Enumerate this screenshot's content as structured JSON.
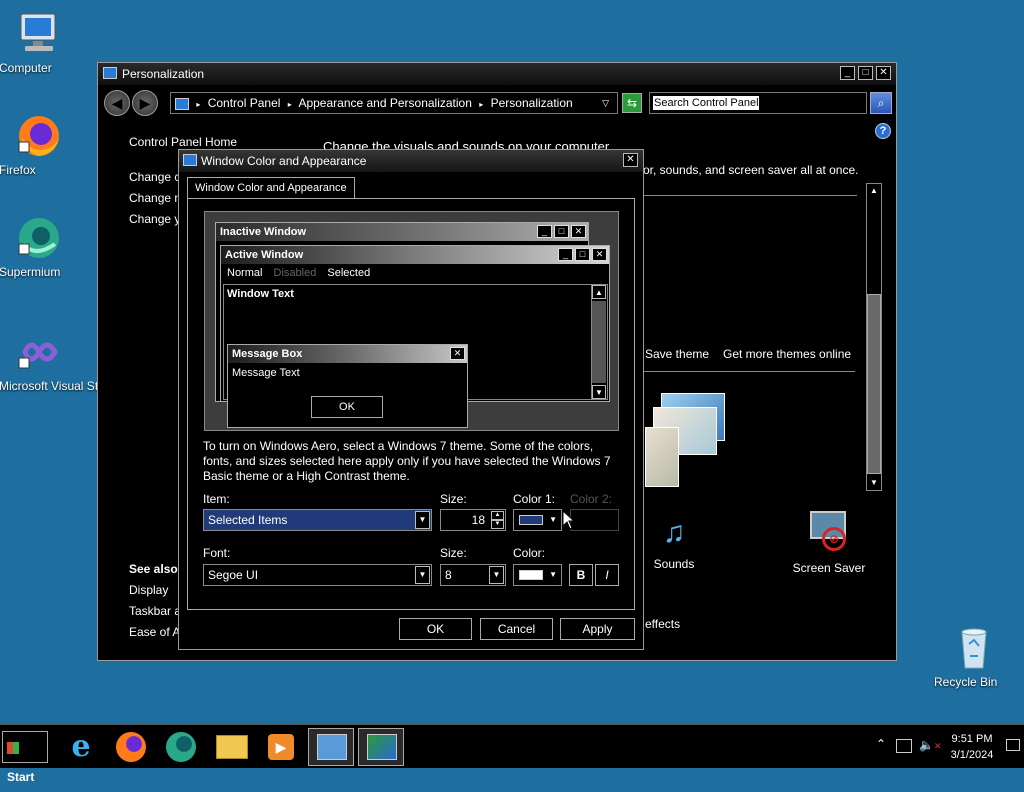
{
  "desktop": {
    "icons": [
      {
        "label": "Computer"
      },
      {
        "label": "Firefox"
      },
      {
        "label": "Supermium"
      },
      {
        "label": "Microsoft Visual Stud..."
      },
      {
        "label": "Recycle Bin"
      }
    ]
  },
  "main_window": {
    "title": "Personalization",
    "breadcrumb": [
      "Control Panel",
      "Appearance and Personalization",
      "Personalization"
    ],
    "search_placeholder": "Search Control Panel",
    "left_nav": {
      "home": "Control Panel Home",
      "links": [
        "Change c",
        "Change m",
        "Change y"
      ],
      "see_also_heading": "See also",
      "see_also": [
        "Display",
        "Taskbar a",
        "Ease of A"
      ]
    },
    "heading": "Change the visuals and sounds on your computer",
    "heading_sub": "or, sounds, and screen saver all at once.",
    "theme_links": {
      "save": "Save theme",
      "online": "Get more themes online"
    },
    "bottom_items": {
      "sounds": "Sounds",
      "screen_saver": "Screen Saver",
      "effects": "effects"
    }
  },
  "dialog": {
    "title": "Window Color and Appearance",
    "tab": "Window Color and Appearance",
    "preview": {
      "inactive_title": "Inactive Window",
      "active_title": "Active Window",
      "menu": [
        "Normal",
        "Disabled",
        "Selected"
      ],
      "window_text": "Window Text",
      "msgbox_title": "Message Box",
      "msgbox_text": "Message Text",
      "msgbox_ok": "OK"
    },
    "info_text": "To turn on Windows Aero, select a Windows 7 theme.  Some of the colors, fonts, and sizes selected here apply only if you have selected the Windows 7 Basic theme or a High Contrast theme.",
    "item_label": "Item:",
    "item_value": "Selected Items",
    "size_label": "Size:",
    "size_value": "18",
    "color1_label": "Color 1:",
    "color2_label": "Color 2:",
    "color1_value": "#203a7a",
    "font_label": "Font:",
    "font_value": "Segoe UI",
    "font_size_label": "Size:",
    "font_size_value": "8",
    "font_color_label": "Color:",
    "font_color_value": "#ffffff",
    "bold": "B",
    "italic": "I",
    "ok": "OK",
    "cancel": "Cancel",
    "apply": "Apply"
  },
  "taskbar": {
    "start": "Start",
    "time": "9:51 PM",
    "date": "3/1/2024"
  }
}
